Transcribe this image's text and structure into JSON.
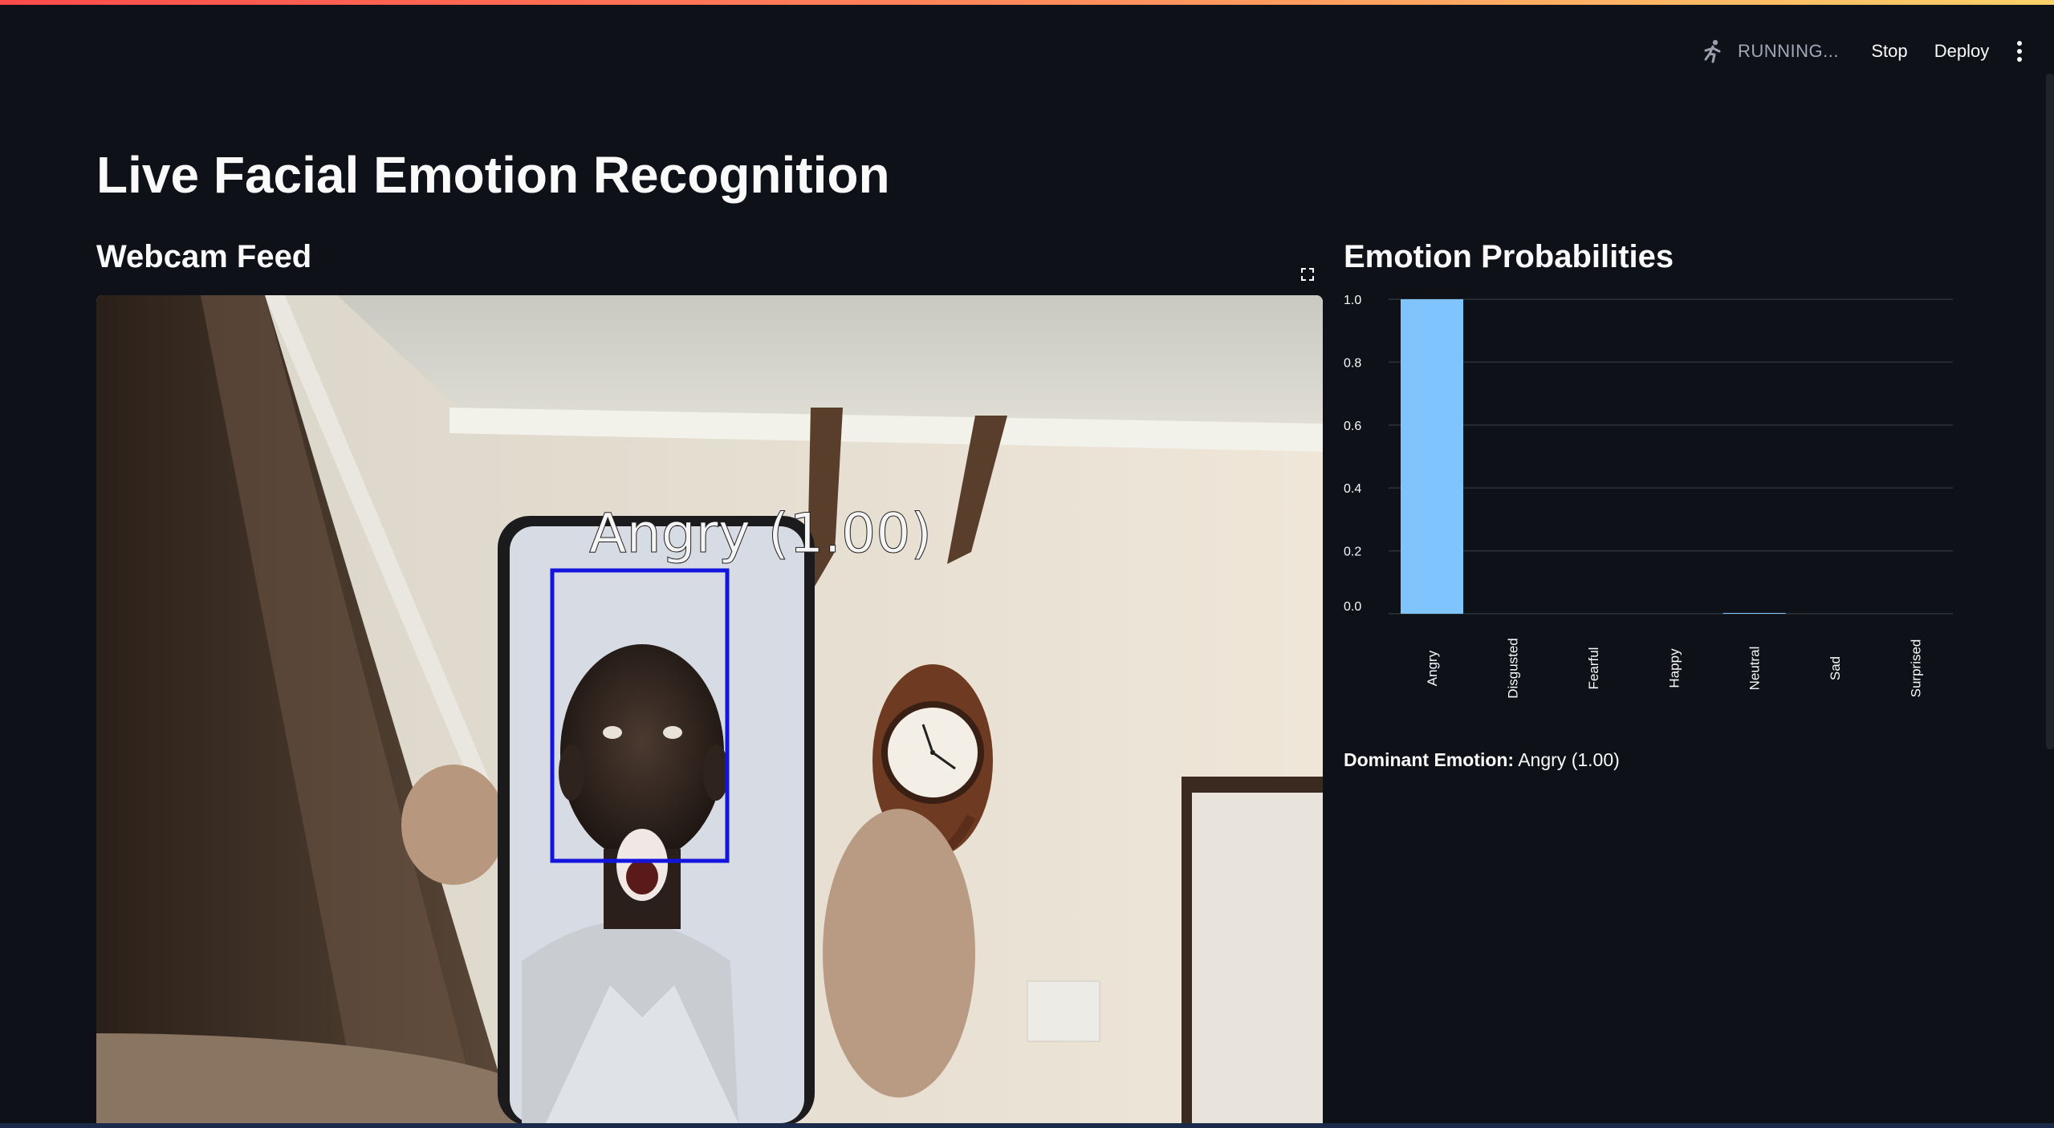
{
  "header": {
    "status_text": "RUNNING...",
    "stop_label": "Stop",
    "deploy_label": "Deploy",
    "status_icon": "running-person-icon",
    "menu_icon": "more-vertical-icon"
  },
  "page": {
    "title": "Live Facial Emotion Recognition"
  },
  "webcam": {
    "title": "Webcam Feed",
    "overlay_label": "Angry (1.00)",
    "fullscreen_icon": "fullscreen-icon"
  },
  "chart": {
    "title": "Emotion Probabilities",
    "bar_color": "#7fc4fd"
  },
  "chart_data": {
    "type": "bar",
    "title": "",
    "categories": [
      "Angry",
      "Disgusted",
      "Fearful",
      "Happy",
      "Neutral",
      "Sad",
      "Surprised"
    ],
    "values": [
      1.0,
      0.0,
      0.0,
      0.0,
      0.002,
      0.0,
      0.0
    ],
    "xlabel": "",
    "ylabel": "",
    "ylim": [
      0,
      1.0
    ],
    "yticks": [
      "0.0",
      "0.2",
      "0.4",
      "0.6",
      "0.8",
      "1.0"
    ],
    "grid": true
  },
  "result": {
    "dominant_label": "Dominant Emotion:",
    "dominant_value": "Angry (1.00)"
  },
  "colors": {
    "background": "#0e1117",
    "accent": "#ff4b4b",
    "bbox": "#1414e0"
  }
}
